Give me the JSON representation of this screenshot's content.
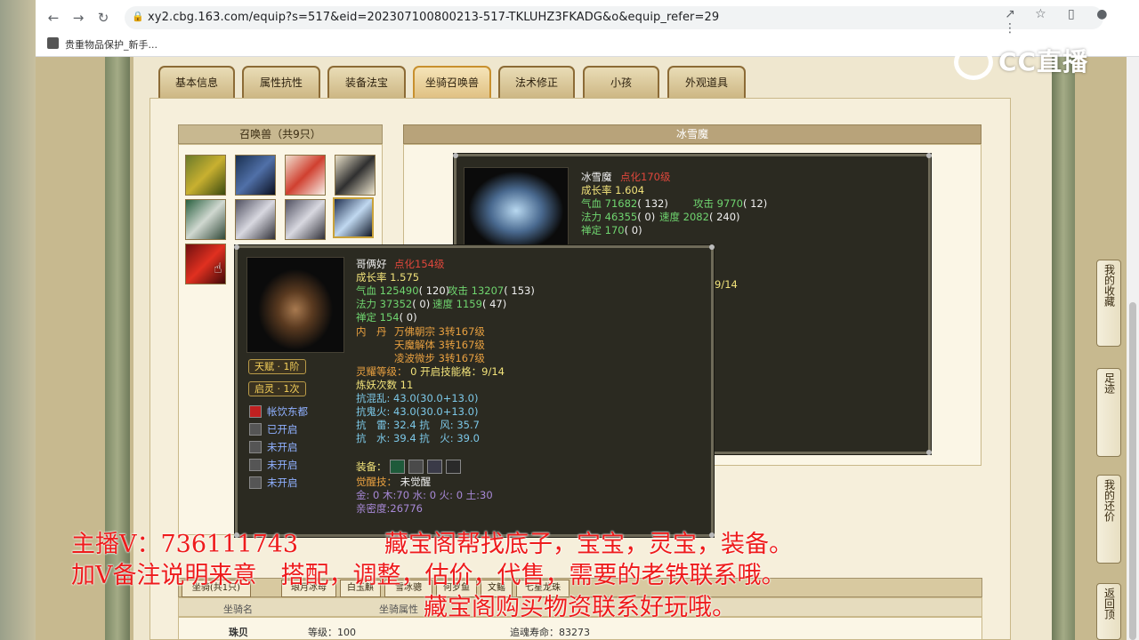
{
  "browser": {
    "url": "xy2.cbg.163.com/equip?s=517&eid=202307100800213-517-TKLUHZ3FKADG&o&equip_refer=29",
    "bookmark": "贵重物品保护_新手..."
  },
  "tabs": [
    "基本信息",
    "属性抗性",
    "装备法宝",
    "坐骑召唤兽",
    "法术修正",
    "小孩",
    "外观道具"
  ],
  "active_tab": "坐骑召唤兽",
  "summon_list": {
    "title": "召唤兽（共9只）"
  },
  "detail_title": "冰雪魔",
  "pet_back": {
    "name": "冰雪魔",
    "level": "点化170级",
    "growth": "成长率 1.604",
    "hp_label": "气血",
    "hp": "71682",
    "hp_p": "( 132)",
    "atk_label": "攻击",
    "atk": "9770",
    "atk_p": "( 12)",
    "mp_label": "法力",
    "mp": "46355",
    "mp_p": "( 0)",
    "spd_label": "速度",
    "spd": "2082",
    "spd_p": "( 240)",
    "ding_label": "禅定",
    "ding": "170",
    "ding_p": "( 0)",
    "partial": "9/14"
  },
  "pet_front": {
    "name": "哥俩好",
    "level": "点化154级",
    "growth": "成长率 1.575",
    "hp_label": "气血",
    "hp": "125490",
    "hp_p": "( 120)",
    "atk_label": "攻击",
    "atk": "13207",
    "atk_p": "( 153)",
    "mp_label": "法力",
    "mp": "37352",
    "mp_p": "( 0)",
    "spd_label": "速度",
    "spd": "1159",
    "spd_p": "( 47)",
    "ding_label": "禅定",
    "ding": "154",
    "ding_p": "( 0)",
    "neidan_label": "内　丹",
    "neidan": [
      "万佛朝宗 3转167级",
      "天魔解体 3转167级",
      "凌波微步 3转167级"
    ],
    "lingyao_label": "灵耀等级：",
    "lingyao": "0 开启技能格：9/14",
    "lianyao": "炼妖次数 11",
    "res1": "抗混乱: 43.0(30.0+13.0)",
    "res2": "抗鬼火: 43.0(30.0+13.0)",
    "res3": "抗　雷: 32.4 抗　风: 35.7",
    "res4": "抗　水: 39.4 抗　火: 39.0",
    "equip_label": "装备：",
    "awaken_label": "觉醒技：",
    "awaken": "未觉醒",
    "elements": "金: 0 木:70 水: 0 火: 0 土:30",
    "intimacy": "亲密度:26776",
    "badges": [
      "天赋 · 1阶",
      "启灵 · 1次"
    ],
    "skills": [
      "帐饮东都",
      "已开启",
      "未开启",
      "未开启",
      "未开启"
    ]
  },
  "bottom": {
    "tabs": [
      "坐骑(共1只)",
      "琅月冰母",
      "白玉麒",
      "雪冰骢",
      "何罗鱼",
      "文鳐",
      "七星龙珠"
    ],
    "col1": "坐骑名",
    "col2": "坐骑属性",
    "row_name": "珠贝",
    "row_level": "等级：100",
    "row_life": "追魂寿命：83273"
  },
  "side_buttons": [
    "我的收藏",
    "足迹",
    "我的还价",
    "返回顶"
  ],
  "watermark": "CC直播",
  "overlay": {
    "line1a": "主播V：736111743",
    "line1b": "藏宝阁帮找底子，宝宝，灵宝，装备。",
    "line2": "加V备注说明来意　搭配，调整，估价，代售，需要的老铁联系哦。",
    "line3": "藏宝阁购买物资联系好玩哦。"
  },
  "colors": {
    "title_red": "#e0473c",
    "stat_green": "#6fd56f",
    "overlay_red": "#ee1c1c"
  }
}
